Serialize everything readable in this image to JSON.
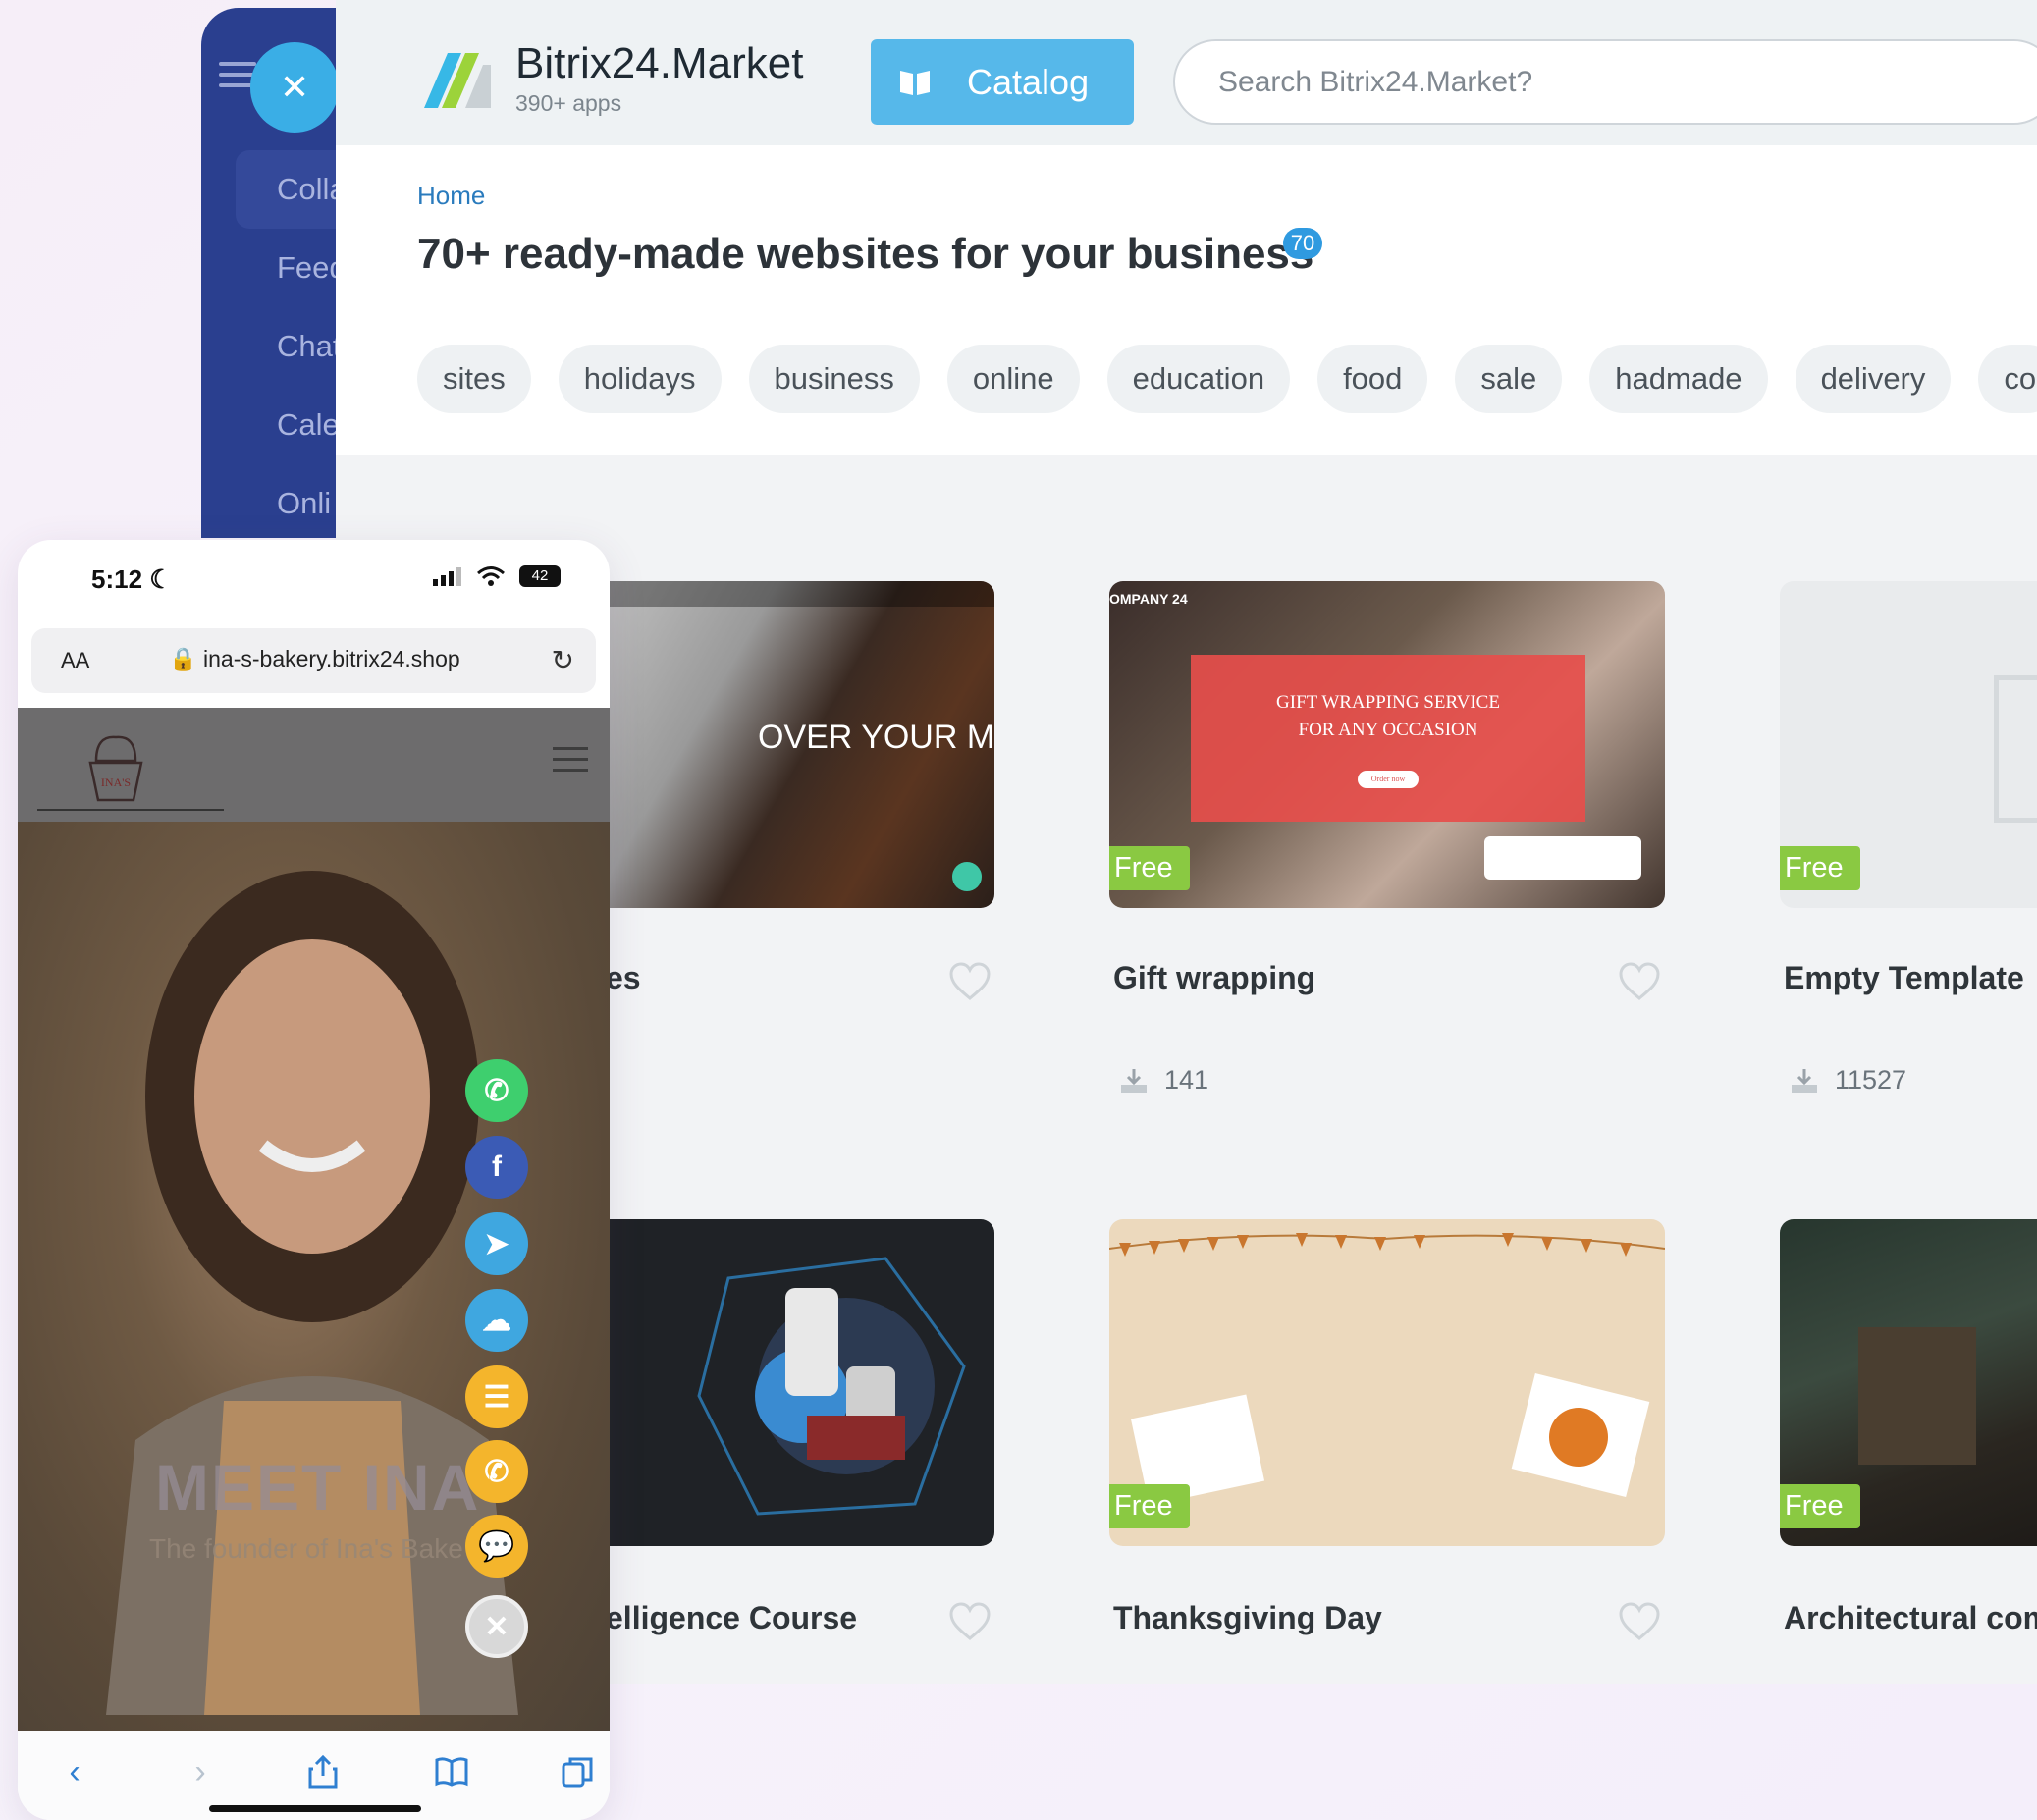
{
  "sidebar": {
    "items": [
      {
        "label": "Colla"
      },
      {
        "label": "Feed"
      },
      {
        "label": "Chat"
      },
      {
        "label": "Cale"
      },
      {
        "label": "Onli"
      }
    ]
  },
  "market": {
    "logo_title": "Bitrix24.Market",
    "logo_sub": "390+ apps",
    "catalog_label": "Catalog",
    "search_placeholder": "Search Bitrix24.Market?",
    "breadcrumb": "Home",
    "heading": "70+ ready-made websites for your business",
    "count_badge": "70",
    "tags": [
      "sites",
      "holidays",
      "business",
      "online",
      "education",
      "food",
      "sale",
      "hadmade",
      "delivery",
      "co"
    ]
  },
  "cards": {
    "music": {
      "img_text": "OVER YOUR MUSIC",
      "title": "es"
    },
    "gift": {
      "img_brand": "OMPANY 24",
      "img_text_1": "GIFT WRAPPING SERVICE",
      "img_text_2": "FOR ANY OCCASION",
      "img_btn": "Order now",
      "free": "Free",
      "title": "Gift wrapping",
      "downloads": "141"
    },
    "empty": {
      "free": "Free",
      "title": "Empty Template",
      "downloads": "11527"
    },
    "ai": {
      "title": "elligence Course"
    },
    "thanks": {
      "free": "Free",
      "title": "Thanksgiving Day"
    },
    "arch": {
      "free": "Free",
      "title": "Architectural com"
    }
  },
  "phone": {
    "time": "5:12",
    "battery": "42",
    "url_aa": "AA",
    "url": "ina-s-bakery.bitrix24.shop",
    "cupcake_text": "INA'S",
    "hero_title": "MEET INA",
    "hero_sub": "The founder of Ina's Bake"
  },
  "colors": {
    "sidebar": "#2a3f8f",
    "accent": "#56b8ea",
    "free_badge": "#8ac942",
    "whatsapp": "#3ecf6e",
    "facebook": "#3b5bb5",
    "telegram": "#3fa7e0",
    "viber_cloud": "#3fa7e0",
    "orange": "#f4b52c"
  }
}
